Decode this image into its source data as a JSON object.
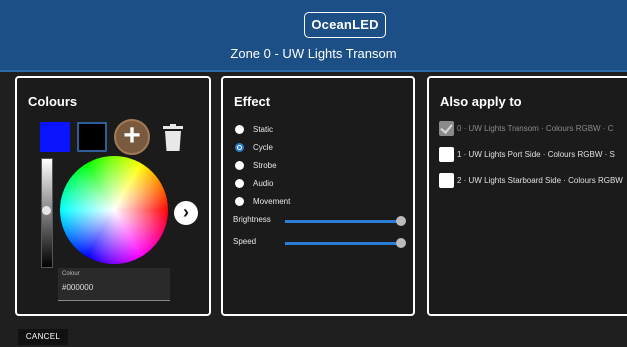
{
  "header": {
    "logo_text": "OceanLED",
    "zone_title": "Zone 0 - UW Lights Transom"
  },
  "colours": {
    "title": "Colours",
    "swatches": [
      "#0a14ff",
      "#000000"
    ],
    "add_icon": "plus-icon",
    "delete_icon": "trash-icon",
    "next_icon": "chevron-right-icon",
    "field_label": "Colour",
    "field_value": "#000000"
  },
  "effect": {
    "title": "Effect",
    "options": [
      "Static",
      "Cycle",
      "Strobe",
      "Audio",
      "Movement"
    ],
    "selected": "Cycle",
    "brightness_label": "Brightness",
    "brightness_value": 1.0,
    "speed_label": "Speed",
    "speed_value": 1.0
  },
  "apply": {
    "title": "Also apply to",
    "items": [
      {
        "label": "0 · UW Lights Transom · Colours RGBW · C",
        "checked": true,
        "disabled": true
      },
      {
        "label": "1 · UW Lights Port Side · Colours RGBW · S",
        "checked": false,
        "disabled": false
      },
      {
        "label": "2 · UW Lights Starboard Side · Colours RGBW",
        "checked": false,
        "disabled": false
      }
    ]
  },
  "footer": {
    "cancel_label": "CANCEL"
  }
}
